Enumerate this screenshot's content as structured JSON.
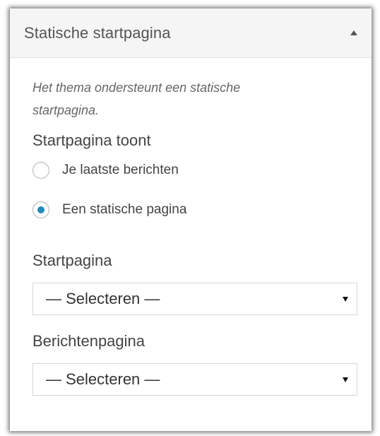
{
  "panel": {
    "title": "Statische startpagina",
    "collapse_icon": "triangle-up-icon"
  },
  "description": "Het thema ondersteunt een statische startpagina.",
  "front_page_displays": {
    "heading": "Startpagina toont",
    "options": [
      {
        "label": "Je laatste berichten",
        "checked": false
      },
      {
        "label": "Een statische pagina",
        "checked": true
      }
    ]
  },
  "front_page": {
    "label": "Startpagina",
    "selected": "— Selecteren —"
  },
  "posts_page": {
    "label": "Berichtenpagina",
    "selected": "— Selecteren —"
  },
  "colors": {
    "radio_checked": "#1e8cbe",
    "header_bg": "#f5f5f5"
  }
}
